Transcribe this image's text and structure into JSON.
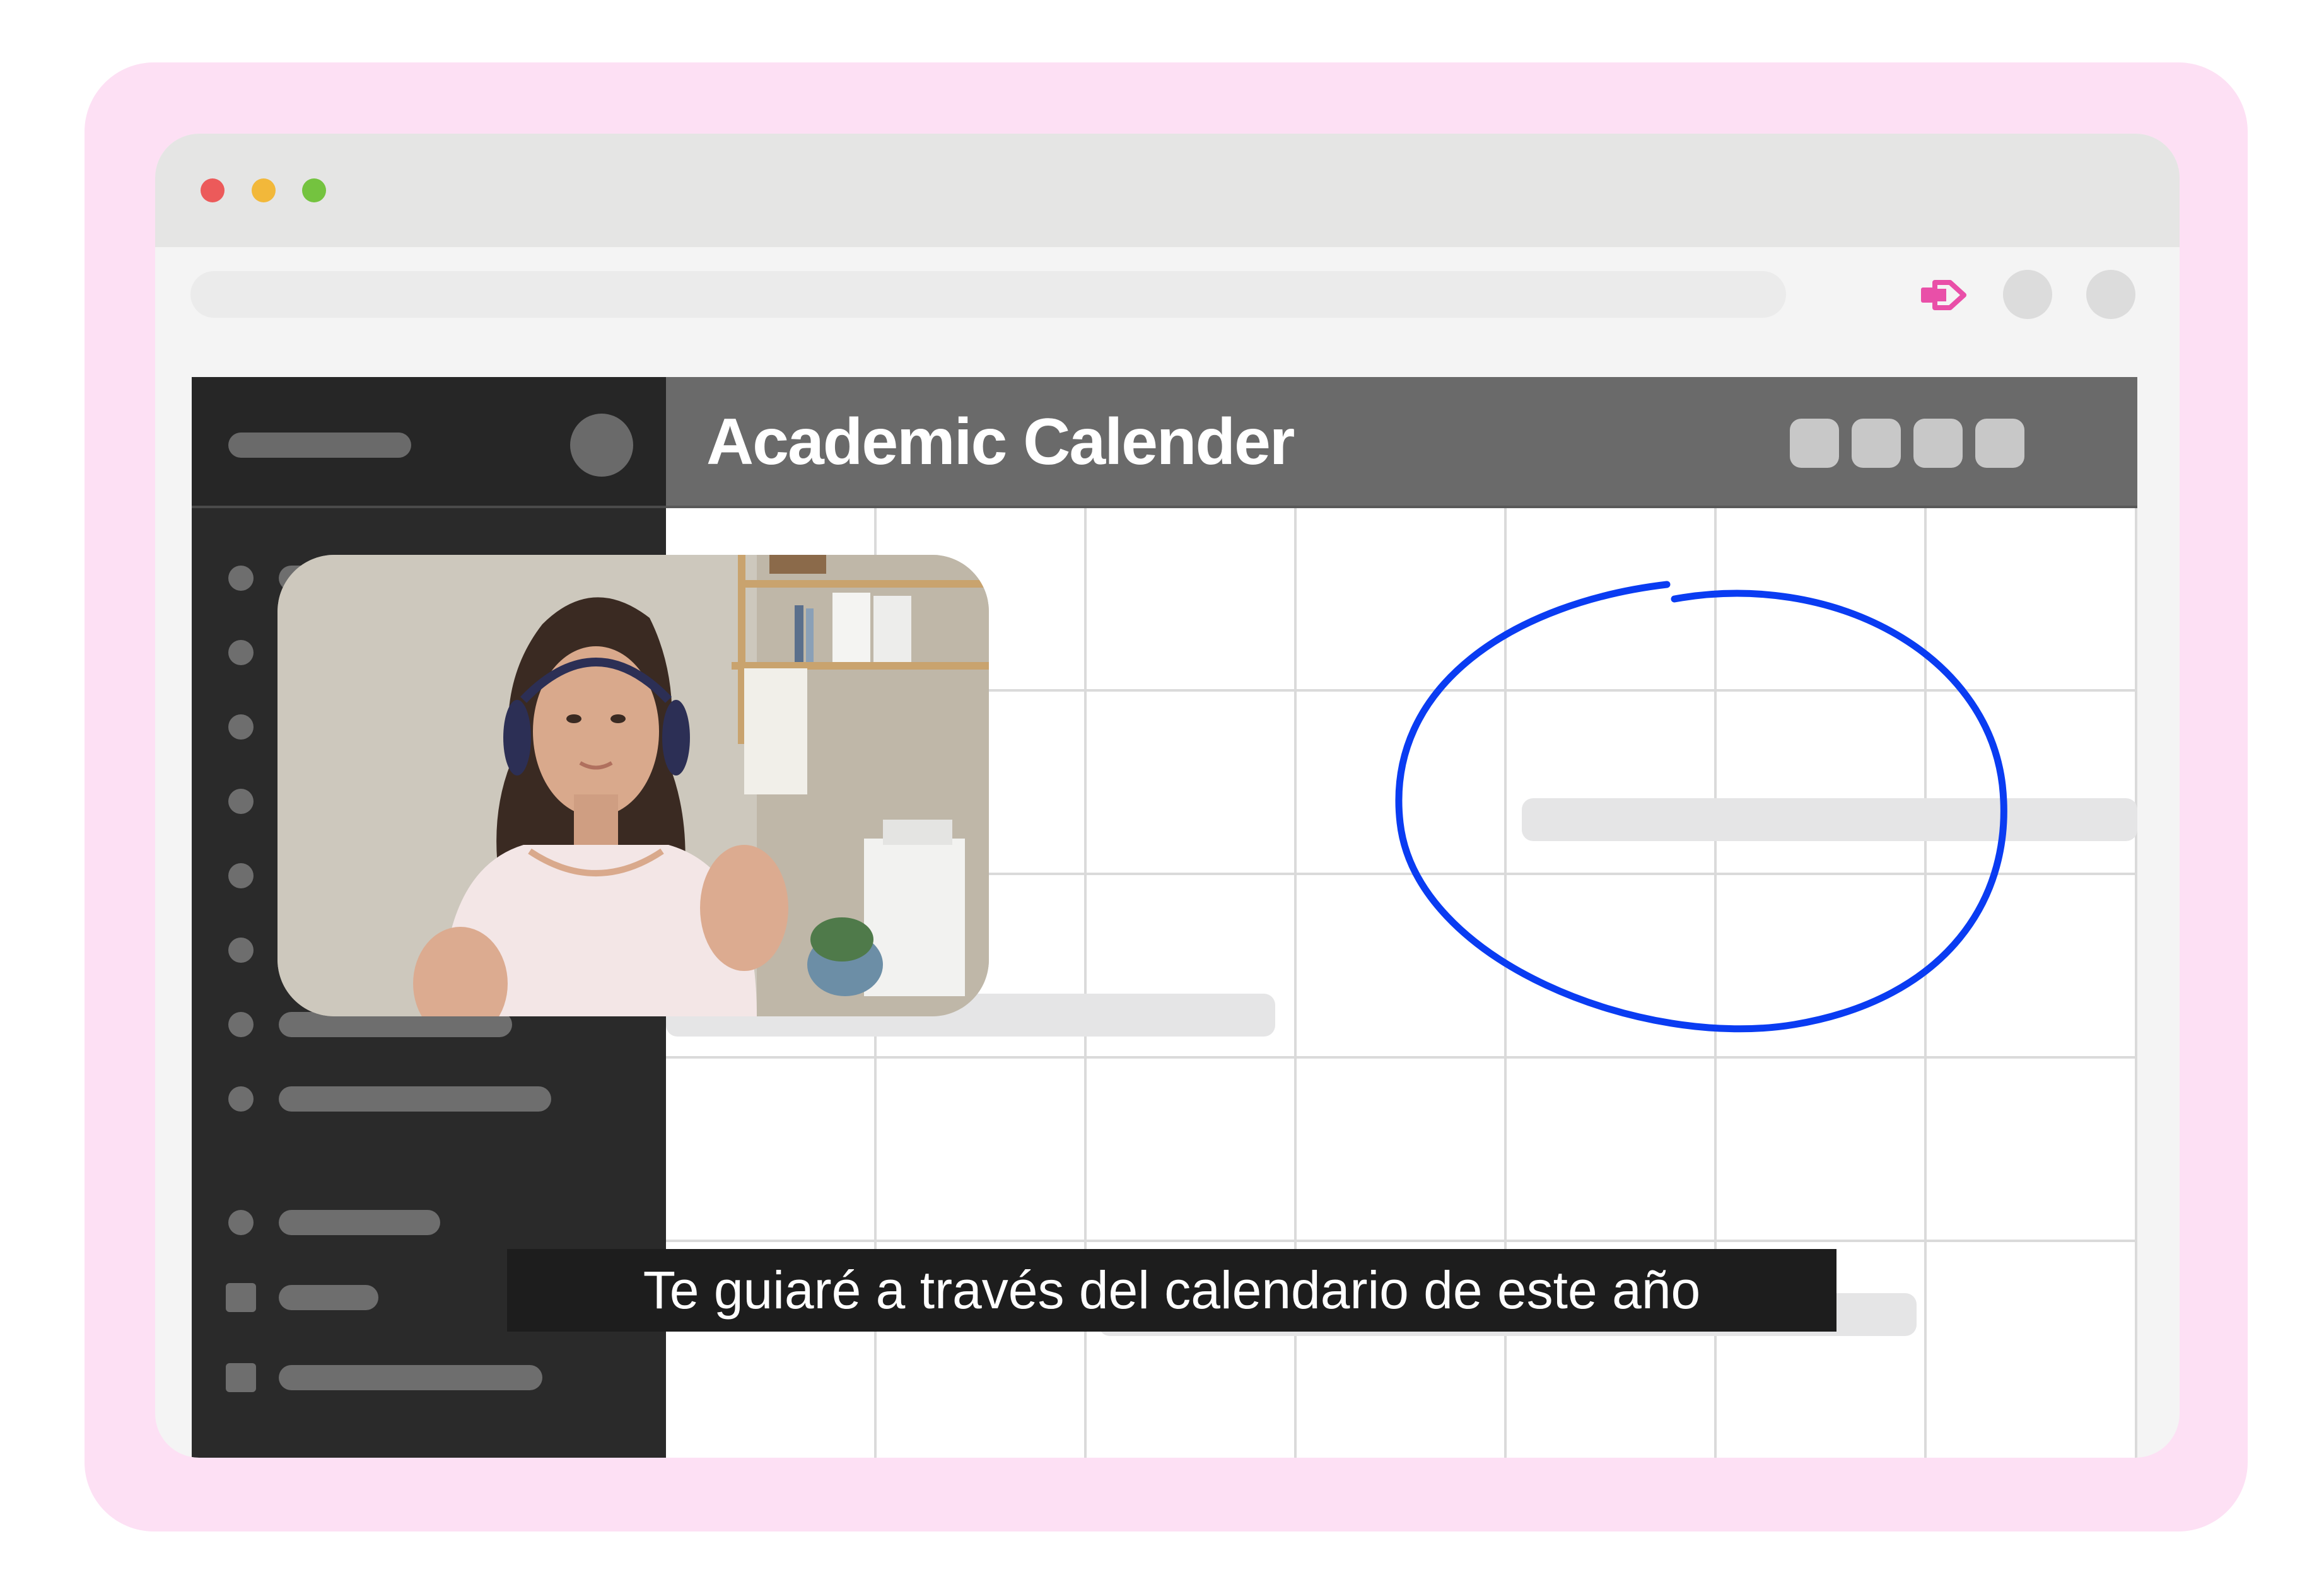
{
  "browser": {
    "window_controls": [
      "close",
      "minimize",
      "maximize"
    ],
    "toolbar_icons": [
      "record-video-icon",
      "profile-icon",
      "menu-icon"
    ],
    "accent_color": "#e94fa8"
  },
  "app": {
    "title": "Academic Calender",
    "header_buttons": 4
  },
  "subtitle": "Te guiaré a través del calendario de este año",
  "annotation": {
    "shape": "circle",
    "color": "#0a3cf2"
  }
}
